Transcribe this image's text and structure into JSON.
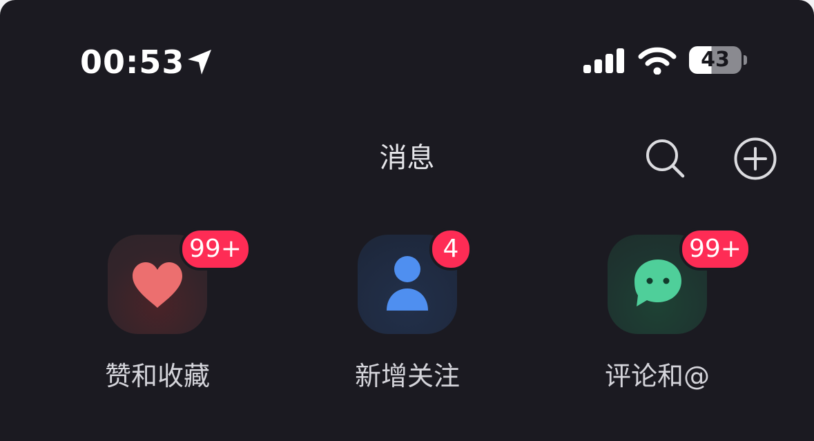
{
  "status_bar": {
    "time": "00:53",
    "battery": "43",
    "icons": [
      "location-arrow-icon",
      "cellular-signal-icon",
      "wifi-icon",
      "battery-icon"
    ]
  },
  "header": {
    "title": "消息",
    "icons": [
      "search-icon",
      "add-circle-icon"
    ]
  },
  "shortcuts": [
    {
      "label": "赞和收藏",
      "badge": "99+",
      "icon": "heart-icon",
      "color": "#ec6f6f"
    },
    {
      "label": "新增关注",
      "badge": "4",
      "icon": "person-icon",
      "color": "#4f8ff0"
    },
    {
      "label": "评论和@",
      "badge": "99+",
      "icon": "chat-bubble-icon",
      "color": "#4fcf9a"
    }
  ],
  "colors": {
    "background": "#1b1a21",
    "badge": "#fe2c55"
  }
}
